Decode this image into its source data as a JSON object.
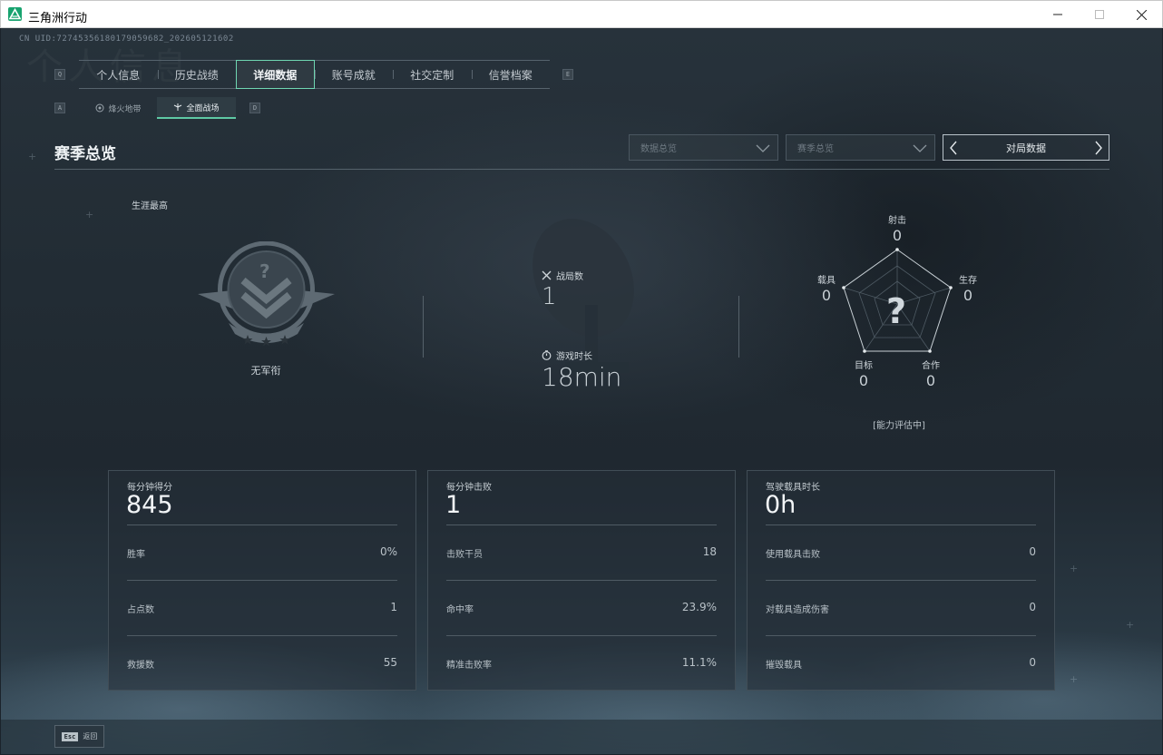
{
  "window": {
    "title": "三角洲行动"
  },
  "background": {
    "watermark": "个人信息"
  },
  "uid": "CN UID:72745356180179059682_202605121602",
  "nav": {
    "prev_key": "Q",
    "next_key": "E",
    "tabs": [
      "个人信息",
      "历史战绩",
      "详细数据",
      "账号成就",
      "社交定制",
      "信誉档案"
    ],
    "active_tab": "详细数据"
  },
  "subnav": {
    "prev_key": "A",
    "next_key": "D",
    "tabs": [
      "烽火地带",
      "全面战场"
    ],
    "active_tab": "全面战场"
  },
  "section": {
    "title": "赛季总览",
    "dropdown1": "数据总览",
    "dropdown2": "赛季总览",
    "nav_label": "对局数据"
  },
  "career": {
    "label": "生涯最高",
    "rank_name": "无军衔",
    "rank_symbol": "?"
  },
  "match_stats": {
    "matches_label": "战局数",
    "matches_value": "1",
    "playtime_label": "游戏时长",
    "playtime_value": "18min"
  },
  "radar": {
    "center_symbol": "?",
    "axes": [
      {
        "label": "射击",
        "value": "0"
      },
      {
        "label": "生存",
        "value": "0"
      },
      {
        "label": "合作",
        "value": "0"
      },
      {
        "label": "目标",
        "value": "0"
      },
      {
        "label": "载具",
        "value": "0"
      }
    ],
    "status": "[能力评估中]"
  },
  "cards": [
    {
      "title": "每分钟得分",
      "value": "845",
      "rows": [
        {
          "label": "胜率",
          "value": "0%"
        },
        {
          "label": "占点数",
          "value": "1"
        },
        {
          "label": "救援数",
          "value": "55"
        }
      ]
    },
    {
      "title": "每分钟击败",
      "value": "1",
      "rows": [
        {
          "label": "击败干员",
          "value": "18"
        },
        {
          "label": "命中率",
          "value": "23.9%"
        },
        {
          "label": "精准击败率",
          "value": "11.1%"
        }
      ]
    },
    {
      "title": "驾驶载具时长",
      "value": "0h",
      "rows": [
        {
          "label": "使用载具击败",
          "value": "0"
        },
        {
          "label": "对载具造成伤害",
          "value": "0"
        },
        {
          "label": "摧毁载具",
          "value": "0"
        }
      ]
    }
  ],
  "footer": {
    "esc_key": "Esc",
    "back_label": "返回"
  },
  "colors": {
    "accent": "#6fd7b2",
    "app_icon": "#18a36f",
    "background": "#1b232b"
  }
}
